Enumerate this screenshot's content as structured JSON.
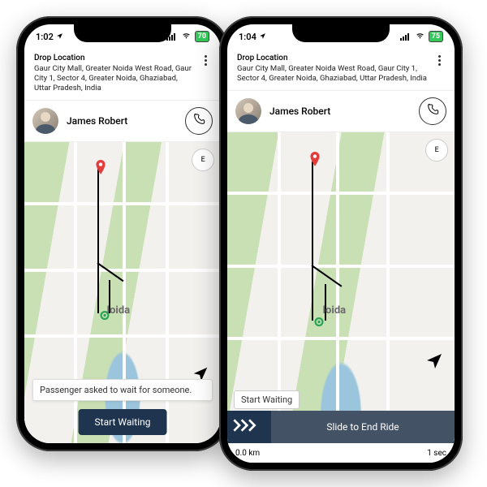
{
  "phone1": {
    "status": {
      "time": "1:02",
      "battery": "70"
    },
    "drop": {
      "label": "Drop Location",
      "address": "Gaur City Mall, Greater Noida West Road, Gaur City 1, Sector 4, Greater Noida, Ghaziabad, Uttar Pradesh, India"
    },
    "passenger": {
      "name": "James Robert"
    },
    "map": {
      "city_label": "loida",
      "compass": "E"
    },
    "message": "Passenger asked to wait for someone.",
    "start_button": "Start Waiting"
  },
  "phone2": {
    "status": {
      "time": "1:04",
      "battery": "75"
    },
    "drop": {
      "label": "Drop Location",
      "address": "Gaur City Mall, Greater Noida West Road, Gaur City 1, Sector 4, Greater Noida, Ghaziabad, Uttar Pradesh, India"
    },
    "passenger": {
      "name": "James Robert"
    },
    "map": {
      "city_label": "loida",
      "compass": "E"
    },
    "start_badge": "Start Waiting",
    "slide_label": "Slide to End Ride",
    "footer": {
      "distance": "0.0 km",
      "duration": "1 sec"
    }
  }
}
